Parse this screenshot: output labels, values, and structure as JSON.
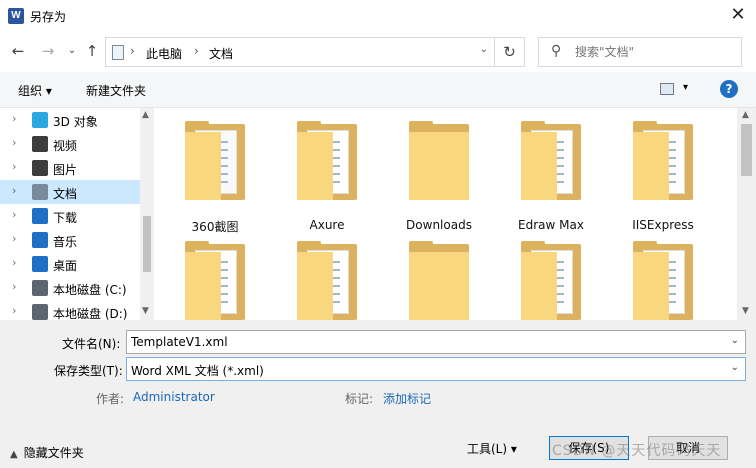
{
  "window": {
    "title": "另存为",
    "app_icon": "W"
  },
  "nav": {
    "breadcrumb": [
      "此电脑",
      "文档"
    ],
    "search_placeholder": "搜索\"文档\""
  },
  "toolbar": {
    "organize_label": "组织 ▾",
    "new_folder_label": "新建文件夹",
    "help_label": "?"
  },
  "tree": {
    "items": [
      {
        "label": "3D 对象",
        "icon": "3d-objects-icon",
        "color": "#29a8e0"
      },
      {
        "label": "视频",
        "icon": "video-icon",
        "color": "#3c3c3c"
      },
      {
        "label": "图片",
        "icon": "pictures-icon",
        "color": "#3c3c3c"
      },
      {
        "label": "文档",
        "icon": "documents-icon",
        "color": "#7a8a9e",
        "selected": true
      },
      {
        "label": "下载",
        "icon": "downloads-icon",
        "color": "#1f6fc5"
      },
      {
        "label": "音乐",
        "icon": "music-icon",
        "color": "#1f6fc5"
      },
      {
        "label": "桌面",
        "icon": "desktop-icon",
        "color": "#1f6fc5"
      },
      {
        "label": "本地磁盘 (C:)",
        "icon": "drive-c-icon",
        "color": "#5c6570"
      },
      {
        "label": "本地磁盘 (D:)",
        "icon": "drive-d-icon",
        "color": "#5c6570"
      }
    ]
  },
  "files": [
    {
      "label": "360截图",
      "style": "img"
    },
    {
      "label": "Axure",
      "style": "docs"
    },
    {
      "label": "Downloads",
      "style": "plain"
    },
    {
      "label": "Edraw Max",
      "style": "docs"
    },
    {
      "label": "IISExpress",
      "style": "docs"
    },
    {
      "label": "",
      "style": "docs"
    },
    {
      "label": "",
      "style": "docs"
    },
    {
      "label": "",
      "style": "plain"
    },
    {
      "label": "",
      "style": "docs"
    },
    {
      "label": "",
      "style": "docs"
    }
  ],
  "form": {
    "filename_label": "文件名(N):",
    "filename_value": "TemplateV1.xml",
    "filetype_label": "保存类型(T):",
    "filetype_value": "Word XML 文档 (*.xml)",
    "author_label": "作者:",
    "author_value": "Administrator",
    "tags_label": "标记:",
    "tags_value": "添加标记",
    "hide_folders_label": "隐藏文件夹",
    "tools_label": "工具(L)",
    "save_label": "保存(S)",
    "cancel_label": "取消",
    "watermark_text": "CSDN @天天代码码天天"
  },
  "colors": {
    "accent": "#0078d7",
    "folder_back": "#dcb25f",
    "folder_front": "#f8d77f",
    "selection": "#cce8ff"
  }
}
